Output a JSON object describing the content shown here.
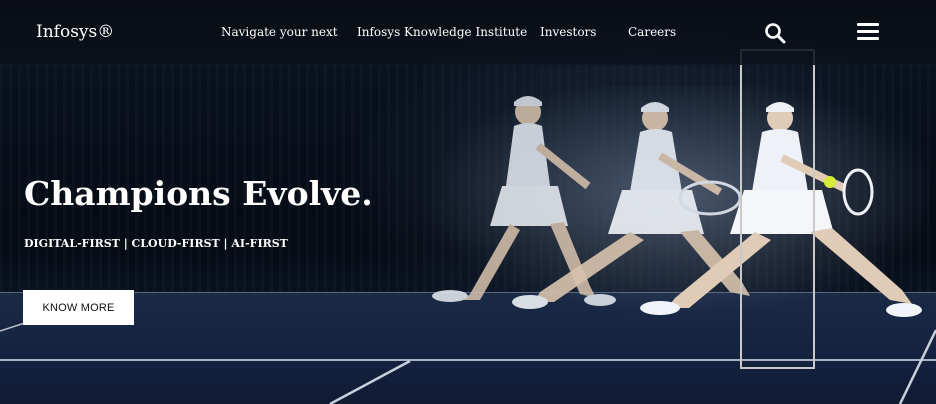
{
  "header": {
    "logo": "Infosys®",
    "nav": [
      {
        "label": "Navigate your next"
      },
      {
        "label": "Infosys Knowledge Institute"
      },
      {
        "label": "Investors"
      },
      {
        "label": "Careers"
      }
    ],
    "icons": {
      "search": "search-icon",
      "menu": "hamburger-menu-icon"
    }
  },
  "hero": {
    "headline": "Champions Evolve.",
    "tagline": "DIGITAL-FIRST | CLOUD-FIRST | AI-FIRST",
    "cta_label": "KNOW MORE"
  },
  "colors": {
    "background": "#05080f",
    "court": "#142240",
    "text": "#ffffff",
    "button_bg": "#ffffff"
  }
}
